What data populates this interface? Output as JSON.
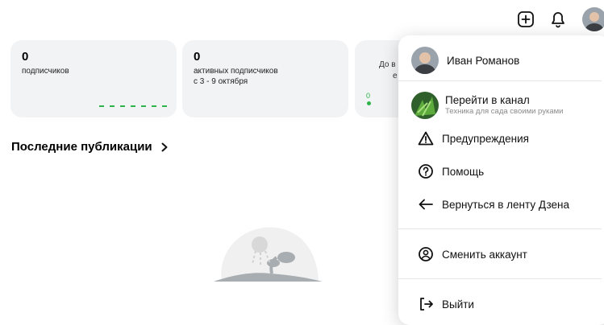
{
  "cards": [
    {
      "number": "0",
      "label": "подписчиков"
    },
    {
      "number": "0",
      "label_line1": "активных подписчиков",
      "label_line2": "с 3 - 9 октября"
    },
    {
      "partial_line1": "До в",
      "partial_line2": "е",
      "chart_zero": "0"
    }
  ],
  "section": {
    "title": "Последние публикации"
  },
  "menu": {
    "profile_name": "Иван Романов",
    "channel_title": "Перейти в канал",
    "channel_subtitle": "Техника для сада своими руками",
    "items": [
      {
        "label": "Предупреждения",
        "icon": "warning-icon"
      },
      {
        "label": "Помощь",
        "icon": "help-icon"
      },
      {
        "label": "Вернуться в ленту Дзена",
        "icon": "arrow-left-icon"
      },
      {
        "label": "Сменить аккаунт",
        "icon": "user-circle-icon"
      },
      {
        "label": "Выйти",
        "icon": "logout-icon"
      }
    ]
  },
  "topbar": {
    "icons": [
      "add-icon",
      "bell-icon",
      "avatar"
    ]
  },
  "colors": {
    "accent_green": "#2db34a",
    "card_bg": "#f2f3f5"
  }
}
